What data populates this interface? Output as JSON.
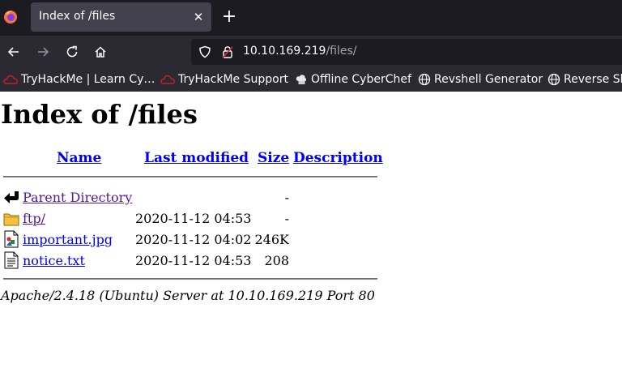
{
  "browser": {
    "tab": {
      "title": "Index of /files"
    },
    "url": {
      "host": "10.10.169.219",
      "path": "/files/"
    },
    "bookmarks": [
      {
        "label": "TryHackMe | Learn Cy…",
        "icon": "tryhackme-icon"
      },
      {
        "label": "TryHackMe Support",
        "icon": "tryhackme-icon"
      },
      {
        "label": "Offline CyberChef",
        "icon": "chef-hat-icon"
      },
      {
        "label": "Revshell Generator",
        "icon": "globe-icon"
      },
      {
        "label": "Reverse Sh",
        "icon": "globe-icon"
      }
    ]
  },
  "page": {
    "title": "Index of /files",
    "columns": {
      "name": "Name",
      "last_modified": "Last modified",
      "size": "Size",
      "description": "Description"
    },
    "rows": [
      {
        "name": "Parent Directory",
        "date": "",
        "size": "-",
        "icon": "parent-directory-icon"
      },
      {
        "name": "ftp/",
        "date": "2020-11-12 04:53",
        "size": "-",
        "icon": "folder-icon"
      },
      {
        "name": "important.jpg",
        "date": "2020-11-12 04:02",
        "size": "246K",
        "icon": "image-file-icon"
      },
      {
        "name": "notice.txt",
        "date": "2020-11-12 04:53",
        "size": "208",
        "icon": "text-file-icon"
      }
    ],
    "footer": "Apache/2.4.18 (Ubuntu) Server at 10.10.169.219 Port 80"
  },
  "colors": {
    "link": "#0000ee",
    "visited": "#551a8b",
    "chrome_dark": "#1c1b22",
    "chrome": "#2b2a33",
    "tab": "#42414d"
  }
}
